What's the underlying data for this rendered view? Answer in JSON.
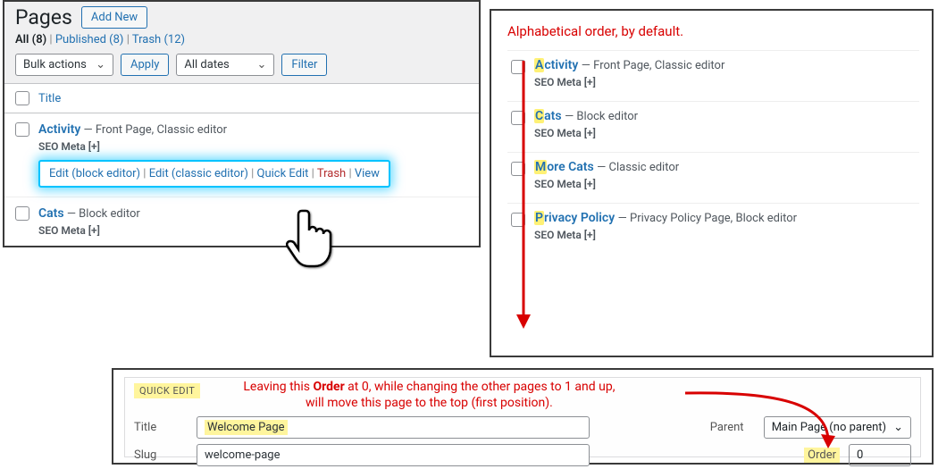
{
  "pages": {
    "heading": "Pages",
    "add_new": "Add New",
    "subsub": {
      "all_label": "All",
      "all_count": "(8)",
      "published_label": "Published",
      "published_count": "(8)",
      "trash_label": "Trash",
      "trash_count": "(12)"
    },
    "bulk_actions": "Bulk actions",
    "apply": "Apply",
    "all_dates": "All dates",
    "filter": "Filter",
    "col_title": "Title",
    "rows": [
      {
        "title": "Activity",
        "extra": " — Front Page, Classic editor",
        "seo": "SEO Meta [+]",
        "actions": {
          "edit_block": "Edit (block editor)",
          "edit_classic": "Edit (classic editor)",
          "quick_edit": "Quick Edit",
          "trash": "Trash",
          "view": "View"
        }
      },
      {
        "title": "Cats",
        "extra": " — Block editor",
        "seo": "SEO Meta [+]"
      }
    ]
  },
  "right": {
    "annotation": "Alphabetical order, by default.",
    "items": [
      {
        "first": "A",
        "rest": "ctivity",
        "extra": " — Front Page, Classic editor",
        "seo": "SEO Meta [+]"
      },
      {
        "first": "C",
        "rest": "ats",
        "extra": " — Block editor",
        "seo": "SEO Meta [+]"
      },
      {
        "first": "M",
        "rest": "ore Cats",
        "extra": " — Classic editor",
        "seo": "SEO Meta [+]"
      },
      {
        "first": "P",
        "rest": "rivacy Policy",
        "extra": " — Privacy Policy Page, Block editor",
        "seo": "SEO Meta [+]"
      }
    ]
  },
  "qe": {
    "badge": "QUICK EDIT",
    "annotation_l1": "Leaving this ",
    "annotation_b": "Order",
    "annotation_l1b": " at 0, while changing the other pages to 1 and up,",
    "annotation_l2": "will move this page to the top (first position).",
    "title_label": "Title",
    "title_value": "Welcome Page",
    "slug_label": "Slug",
    "slug_value": "welcome-page",
    "parent_label": "Parent",
    "parent_value": "Main Page (no parent)",
    "order_label": "Order",
    "order_value": "0"
  }
}
